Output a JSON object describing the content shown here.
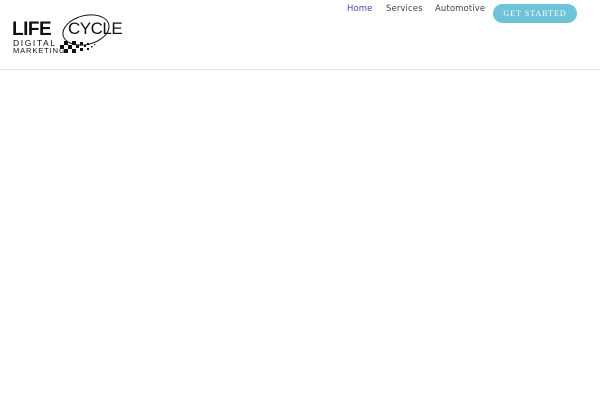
{
  "logo": {
    "word_life": "LIFE",
    "word_cycle": "CYCLE",
    "line1": "DIGITAL",
    "line2": "MARKETING"
  },
  "nav": {
    "items": [
      {
        "label": "Home",
        "active": true
      },
      {
        "label": "Services",
        "active": false
      },
      {
        "label": "Automotive",
        "active": false
      }
    ]
  },
  "cta": {
    "label": "GET STARTED"
  },
  "colors": {
    "accent": "#6fc3d9",
    "nav_active": "#5b3fa6",
    "nav_text": "#444444",
    "divider": "#e4e4e4"
  }
}
